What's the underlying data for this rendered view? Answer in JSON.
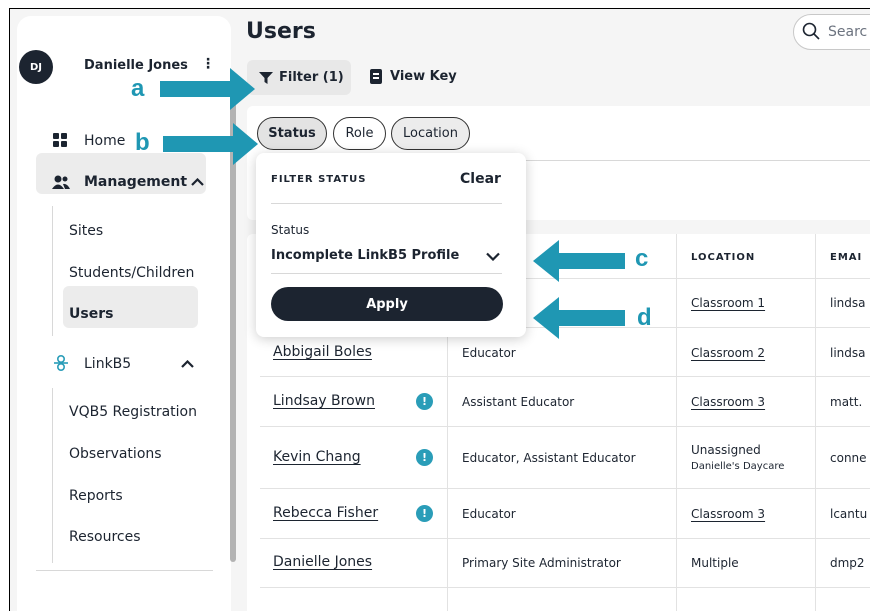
{
  "user": {
    "initials": "DJ",
    "name": "Danielle Jones",
    "menu": "⋮"
  },
  "sidebar": {
    "home": "Home",
    "management": "Management",
    "management_items": [
      "Sites",
      "Students/Children",
      "Users"
    ],
    "linkb5": "LinkB5",
    "linkb5_items": [
      "VQB5 Registration",
      "Observations",
      "Reports",
      "Resources"
    ]
  },
  "header": {
    "title": "Users",
    "search_placeholder": "Searc"
  },
  "toolbar": {
    "filter_label": "Filter (1)",
    "view_key_label": "View Key"
  },
  "filter_chips": [
    "Status",
    "Role",
    "Location"
  ],
  "popup": {
    "title": "FILTER STATUS",
    "clear": "Clear",
    "field_label": "Status",
    "field_value": "Incomplete LinkB5 Profile",
    "apply": "Apply"
  },
  "table": {
    "headers": {
      "location": "LOCATION",
      "email": "EMAI"
    },
    "rows": [
      {
        "name": "",
        "role": "",
        "location": "Classroom 1",
        "email": "lindsa",
        "warn": false
      },
      {
        "name": "Abbigail Boles",
        "role": "Educator",
        "location": "Classroom 2",
        "email": "lindsa",
        "warn": false
      },
      {
        "name": "Lindsay Brown",
        "role": "Assistant Educator",
        "location": "Classroom 3",
        "email": "matt.",
        "warn": true
      },
      {
        "name": "Kevin Chang",
        "role": "Educator, Assistant Educator",
        "location": "Unassigned",
        "location_sub": "Danielle's Daycare",
        "email": "conne",
        "warn": true
      },
      {
        "name": "Rebecca Fisher",
        "role": "Educator",
        "location": "Classroom 3",
        "email": "lcantu",
        "warn": true
      },
      {
        "name": "Danielle Jones",
        "role": "Primary Site Administrator",
        "location": "Multiple",
        "email": "dmp2",
        "warn": false
      }
    ]
  },
  "annotations": {
    "a": "a",
    "b": "b",
    "c": "c",
    "d": "d",
    "color": "#1f97b3"
  }
}
